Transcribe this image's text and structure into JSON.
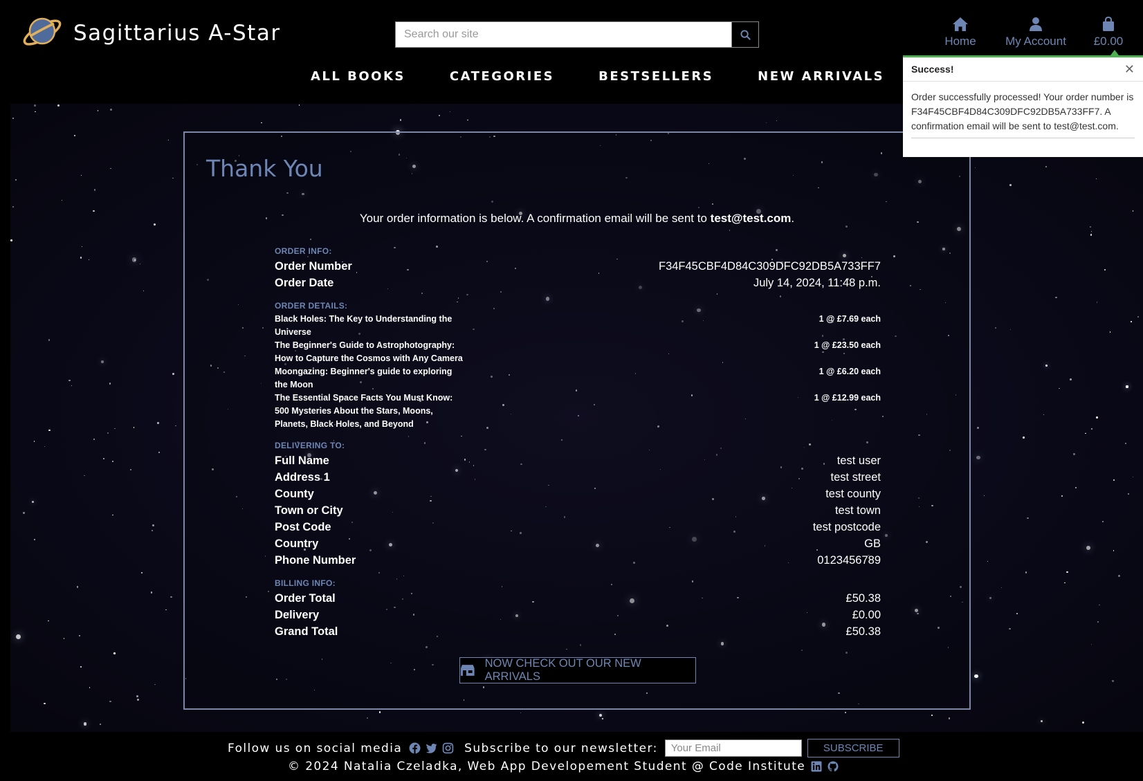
{
  "header": {
    "site_name": "Sagittarius A-Star",
    "search_placeholder": "Search our site",
    "nav_icons": [
      {
        "label": "Home",
        "icon": "home-icon"
      },
      {
        "label": "My Account",
        "icon": "user-icon"
      },
      {
        "label": "£0.00",
        "icon": "bag-icon"
      }
    ],
    "main_nav": [
      "ALL BOOKS",
      "CATEGORIES",
      "BESTSELLERS",
      "NEW ARRIVALS"
    ]
  },
  "toast": {
    "title": "Success!",
    "message": "Order successfully processed! Your order number is F34F45CBF4D84C309DFC92DB5A733FF7. A confirmation email will be sent to test@test.com.",
    "accent_color": "#4caf50"
  },
  "page": {
    "title": "Thank You",
    "intro_prefix": "Your order information is below. A confirmation email will be sent to",
    "intro_email": "test@test.com",
    "intro_suffix": "."
  },
  "order_info": {
    "label": "ORDER INFO:",
    "number_label": "Order Number",
    "number": "F34F45CBF4D84C309DFC92DB5A733FF7",
    "date_label": "Order Date",
    "date": "July 14, 2024, 11:48 p.m."
  },
  "order_details": {
    "label": "ORDER DETAILS:",
    "items": [
      {
        "title": "Black Holes: The Key to Understanding the Universe",
        "qty": "1 @ £7.69 each"
      },
      {
        "title": "The Beginner's Guide to Astrophotography: How to Capture the Cosmos with Any Camera",
        "qty": "1 @ £23.50 each"
      },
      {
        "title": "Moongazing: Beginner's guide to exploring the Moon",
        "qty": "1 @ £6.20 each"
      },
      {
        "title": "The Essential Space Facts You Must Know: 500 Mysteries About the Stars, Moons, Planets, Black Holes, and Beyond",
        "qty": "1 @ £12.99 each"
      }
    ]
  },
  "delivery": {
    "label": "DELIVERING TO:",
    "rows": [
      {
        "k": "Full Name",
        "v": "test user"
      },
      {
        "k": "Address 1",
        "v": "test street"
      },
      {
        "k": "County",
        "v": "test county"
      },
      {
        "k": "Town or City",
        "v": "test town"
      },
      {
        "k": "Post Code",
        "v": "test postcode"
      },
      {
        "k": "Country",
        "v": "GB"
      },
      {
        "k": "Phone Number",
        "v": "0123456789"
      }
    ]
  },
  "billing": {
    "label": "BILLING INFO:",
    "rows": [
      {
        "k": "Order Total",
        "v": "£50.38"
      },
      {
        "k": "Delivery",
        "v": "£0.00"
      },
      {
        "k": "Grand Total",
        "v": "£50.38"
      }
    ]
  },
  "cta": {
    "label": "NOW CHECK OUT OUR NEW ARRIVALS",
    "icon": "store-icon"
  },
  "footer": {
    "follow_text": "Follow us on social media",
    "social_icons": [
      "facebook-icon",
      "twitter-icon",
      "instagram-icon"
    ],
    "newsletter_text": "Subscribe to our newsletter:",
    "email_placeholder": "Your Email",
    "subscribe_label": "SUBSCRIBE",
    "copyright": "© 2024 Natalia Czeladka, Web App Developement Student @ Code Institute",
    "link_icons": [
      "linkedin-icon",
      "github-icon"
    ]
  },
  "colors": {
    "accent": "#6e86b4",
    "background": "#000000",
    "panel_border": "#7c87a8"
  }
}
